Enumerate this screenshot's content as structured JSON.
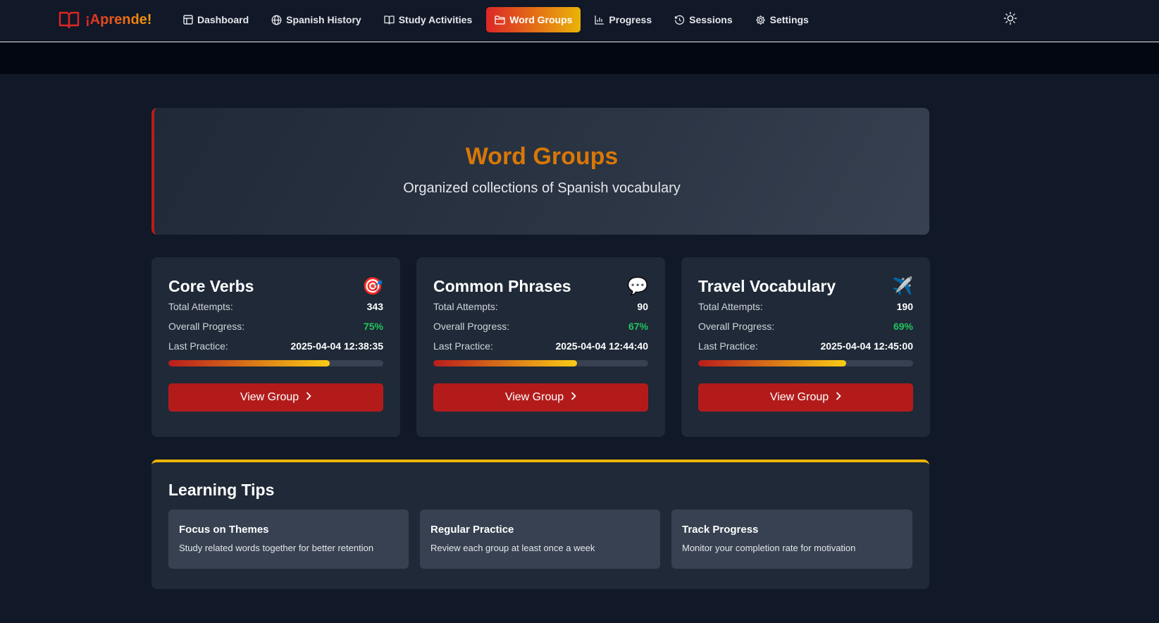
{
  "nav": {
    "brand": "¡Aprende!",
    "items": [
      {
        "label": "Dashboard",
        "icon": "layout-icon",
        "active": false
      },
      {
        "label": "Spanish History",
        "icon": "globe-icon",
        "active": false
      },
      {
        "label": "Study Activities",
        "icon": "book-open-icon",
        "active": false
      },
      {
        "label": "Word Groups",
        "icon": "folder-icon",
        "active": true
      },
      {
        "label": "Progress",
        "icon": "bar-chart-icon",
        "active": false
      },
      {
        "label": "Sessions",
        "icon": "history-icon",
        "active": false
      },
      {
        "label": "Settings",
        "icon": "gear-icon",
        "active": false
      }
    ],
    "theme_toggle_icon": "sun-icon"
  },
  "hero": {
    "title": "Word Groups",
    "subtitle": "Organized collections of Spanish vocabulary"
  },
  "groups": [
    {
      "title": "Core Verbs",
      "emoji": "🎯",
      "attempts_label": "Total Attempts:",
      "attempts": "343",
      "progress_label": "Overall Progress:",
      "progress": "75%",
      "last_label": "Last Practice:",
      "last_practice": "2025-04-04 12:38:35",
      "bar_fraction": 0.75,
      "button": "View Group"
    },
    {
      "title": "Common Phrases",
      "emoji": "💬",
      "attempts_label": "Total Attempts:",
      "attempts": "90",
      "progress_label": "Overall Progress:",
      "progress": "67%",
      "last_label": "Last Practice:",
      "last_practice": "2025-04-04 12:44:40",
      "bar_fraction": 0.67,
      "button": "View Group"
    },
    {
      "title": "Travel Vocabulary",
      "emoji": "✈️",
      "attempts_label": "Total Attempts:",
      "attempts": "190",
      "progress_label": "Overall Progress:",
      "progress": "69%",
      "last_label": "Last Practice:",
      "last_practice": "2025-04-04 12:45:00",
      "bar_fraction": 0.69,
      "button": "View Group"
    }
  ],
  "tips": {
    "title": "Learning Tips",
    "items": [
      {
        "title": "Focus on Themes",
        "text": "Study related words together for better retention"
      },
      {
        "title": "Regular Practice",
        "text": "Review each group at least once a week"
      },
      {
        "title": "Track Progress",
        "text": "Monitor your completion rate for motivation"
      }
    ]
  },
  "colors": {
    "brand_red": "#dc2626",
    "brand_yellow": "#eab308",
    "progress_green": "#22c55e",
    "button_red": "#b31b1b"
  }
}
